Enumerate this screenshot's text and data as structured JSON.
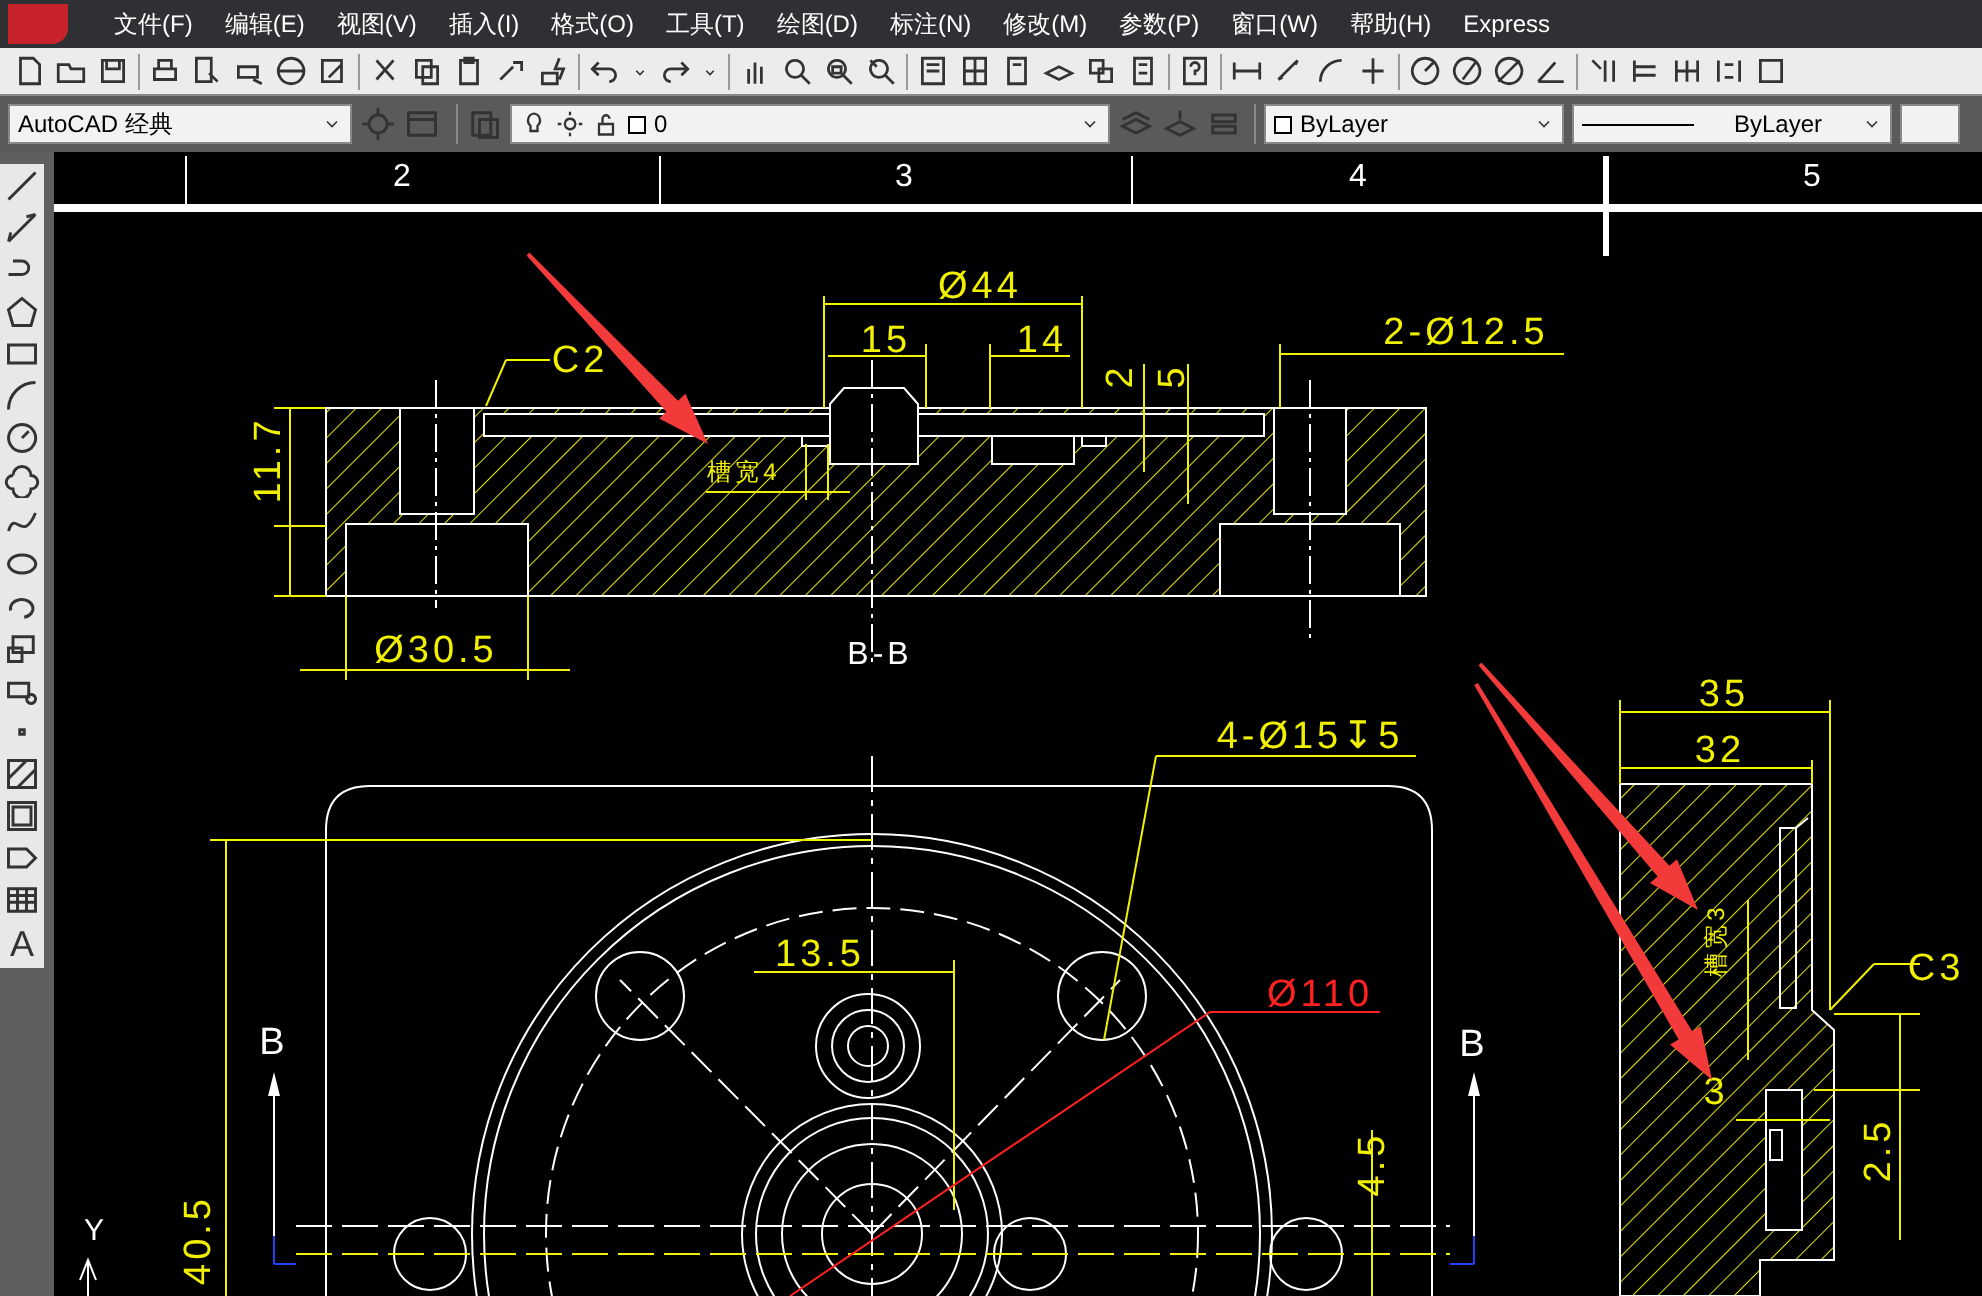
{
  "menu": [
    "文件(F)",
    "编辑(E)",
    "视图(V)",
    "插入(I)",
    "格式(O)",
    "工具(T)",
    "绘图(D)",
    "标注(N)",
    "修改(M)",
    "参数(P)",
    "窗口(W)",
    "帮助(H)",
    "Express"
  ],
  "properties_bar": {
    "workspace": "AutoCAD 经典",
    "layer": "0",
    "color_setting": "ByLayer",
    "linetype": "ByLayer"
  },
  "draw_toolbar": {
    "text_tool": "A"
  },
  "ruler": {
    "labels": [
      "2",
      "3",
      "4",
      "5"
    ]
  },
  "section_view": {
    "title": "B-B",
    "labels": [
      "Ø44",
      "15",
      "14",
      "2",
      "5",
      "2-Ø12.5",
      "C2",
      "11.7",
      "Ø30.5",
      "槽宽4"
    ]
  },
  "top_view": {
    "labels": [
      "4-Ø15↧5",
      "13.5",
      "Ø110",
      "40.5",
      "4.5",
      "B",
      "B",
      "Y"
    ]
  },
  "side_view": {
    "labels": [
      "35",
      "32",
      "C3",
      "槽宽3",
      "3",
      "2.5"
    ]
  }
}
